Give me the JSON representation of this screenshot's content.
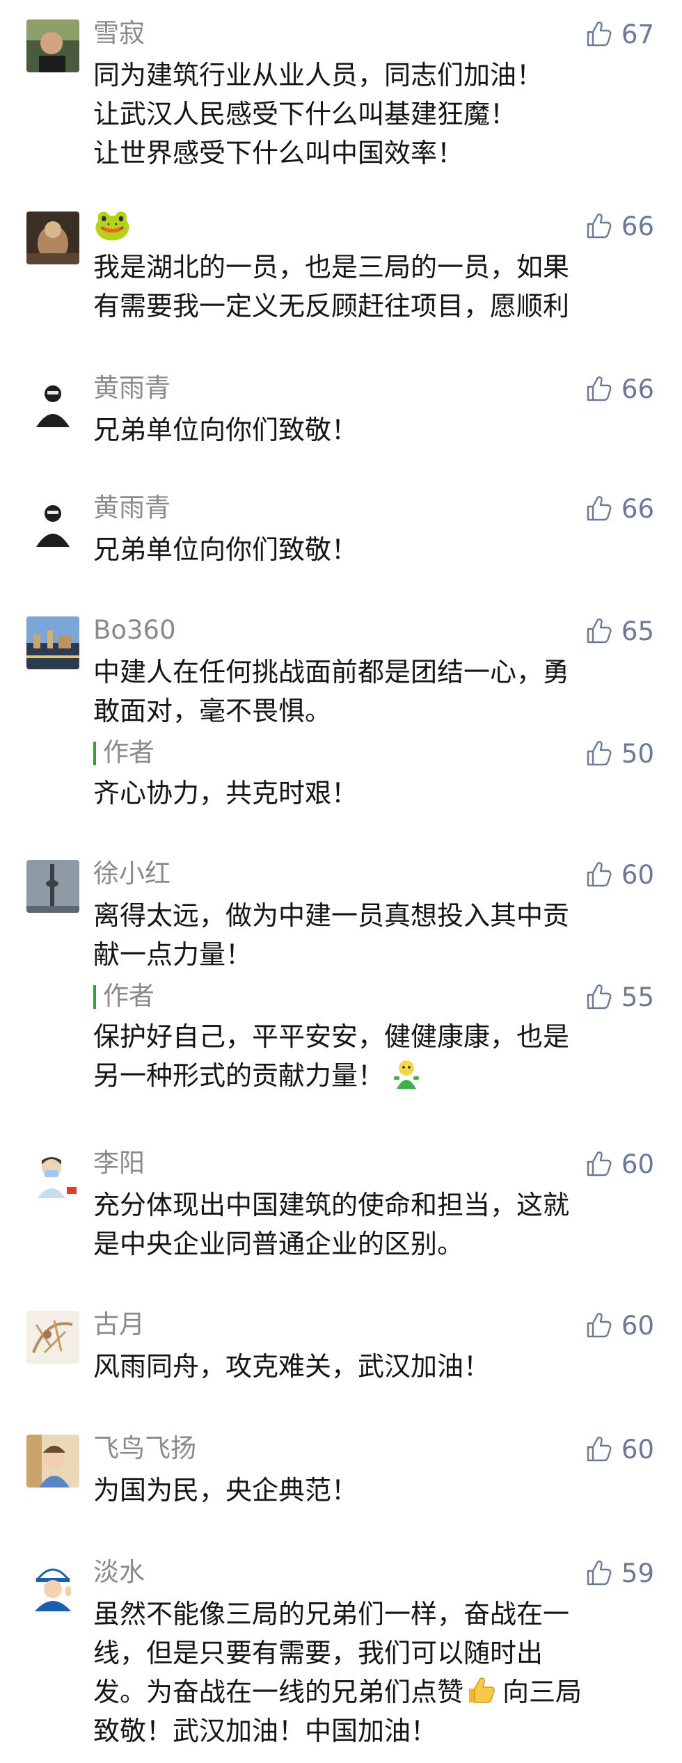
{
  "comments": [
    {
      "name": "雪寂",
      "likes": "67",
      "lines": [
        "同为建筑行业从业人员，同志们加油！",
        "让武汉人民感受下什么叫基建狂魔！",
        "让世界感受下什么叫中国效率！"
      ]
    },
    {
      "name": "🐸",
      "likes": "66",
      "lines": [
        "我是湖北的一员，也是三局的一员，如果",
        "有需要我一定义无反顾赶往项目，愿顺利"
      ]
    },
    {
      "name": "黄雨青",
      "likes": "66",
      "lines": [
        "兄弟单位向你们致敬！"
      ]
    },
    {
      "name": "黄雨青",
      "likes": "66",
      "lines": [
        "兄弟单位向你们致敬！"
      ]
    },
    {
      "name": "Bo360",
      "likes": "65",
      "lines": [
        "中建人在任何挑战面前都是团结一心，勇",
        "敢面对，毫不畏惧。"
      ],
      "reply": {
        "label": "作者",
        "likes": "50",
        "lines": [
          "齐心协力，共克时艰！"
        ]
      }
    },
    {
      "name": "徐小红",
      "likes": "60",
      "lines": [
        "离得太远，做为中建一员真想投入其中贡",
        "献一点力量！"
      ],
      "reply": {
        "label": "作者",
        "likes": "55",
        "lines": [
          "保护好自己，平平安安，健健康康，也是",
          "另一种形式的贡献力量！"
        ]
      }
    },
    {
      "name": "李阳",
      "likes": "60",
      "lines": [
        "充分体现出中国建筑的使命和担当，这就",
        "是中央企业同普通企业的区别。"
      ]
    },
    {
      "name": "古月",
      "likes": "60",
      "lines": [
        "风雨同舟，攻克难关，武汉加油！"
      ]
    },
    {
      "name": "飞鸟飞扬",
      "likes": "60",
      "lines": [
        "为国为民，央企典范！"
      ]
    },
    {
      "name": "淡水",
      "likes": "59",
      "lines": [
        "虽然不能像三局的兄弟们一样，奋战在一",
        "线，但是只要有需要，我们可以随时出",
        "发。为奋战在一线的兄弟们点赞",
        "致敬！武汉加油！中国加油！"
      ],
      "line3_suffix": "向三局"
    }
  ]
}
